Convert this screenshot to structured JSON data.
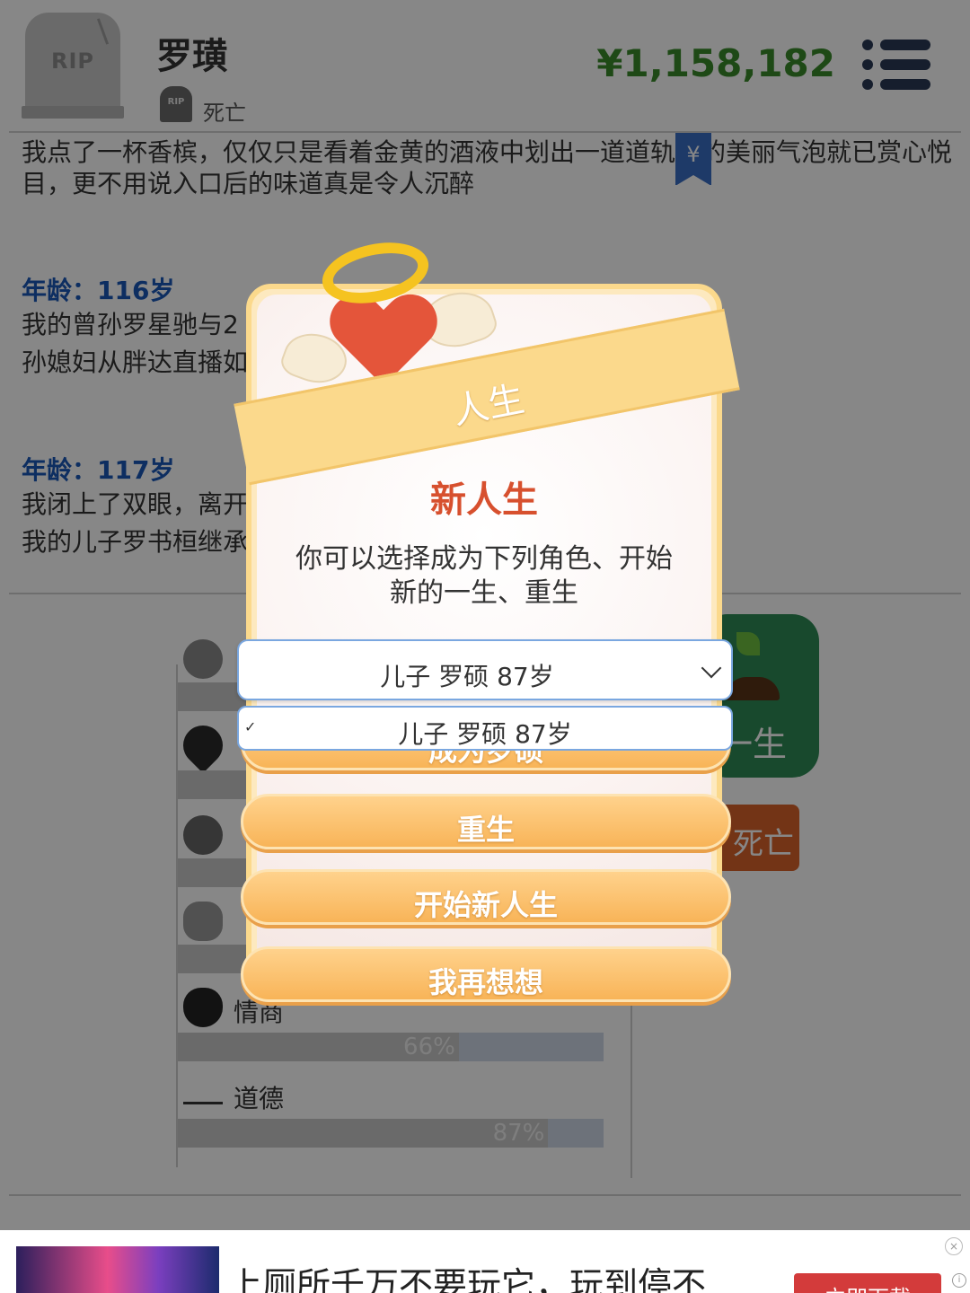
{
  "header": {
    "tombstone_text": "RIP",
    "name": "罗璜",
    "status_icon_text": "RIP",
    "status": "死亡",
    "money": "¥1,158,182",
    "menu_icon": "menu-list-icon"
  },
  "log": {
    "entry0_text": "我点了一杯香槟，仅仅只是看着金黄的酒液中划出一道道轨迹的美丽气泡就已赏心悦目，更不用说入口后的味道真是令人沉醉",
    "bookmark_symbol": "¥",
    "entries": [
      {
        "age": "年龄：116岁",
        "line1": "我的曾孙罗星驰与2",
        "line2": "孙媳妇从胖达直播如"
      },
      {
        "age": "年龄：117岁",
        "line1": "我闭上了双眼，离开",
        "line2": "我的儿子罗书桓继承"
      }
    ]
  },
  "stats": {
    "items": [
      {
        "icon": "face-icon",
        "label": "",
        "percent": ""
      },
      {
        "icon": "heart-icon",
        "label": "",
        "percent": ""
      },
      {
        "icon": "sun-icon",
        "label": "",
        "percent": ""
      },
      {
        "icon": "brain-icon",
        "label": "",
        "percent": ""
      },
      {
        "icon": "apple-icon",
        "label": "情商",
        "percent": "66%",
        "value": 0.66
      },
      {
        "icon": "scales-icon",
        "label": "道德",
        "percent": "87%",
        "value": 0.87
      }
    ],
    "side_green_label": "一生",
    "side_orange_label": "死亡"
  },
  "modal": {
    "ribbon_title": "人生",
    "title": "新人生",
    "description": "你可以选择成为下列角色、开始新的一生、重生",
    "select_value": "儿子 罗硕 87岁",
    "dropdown_option": "儿子 罗硕 87岁",
    "buttons": {
      "become": "成为罗硕",
      "rebirth": "重生",
      "new_life": "开始新人生",
      "rethink": "我再想想"
    }
  },
  "ad": {
    "text": "上厕所千万不要玩它，玩到停不",
    "button": "立即下载",
    "close": "×",
    "info": "i"
  },
  "colors": {
    "money": "#3a8a2b",
    "age_blue": "#1a57b8",
    "title_red": "#d7502e",
    "button_orange": "#f8b458",
    "ribbon_yellow": "#fbd98c"
  }
}
